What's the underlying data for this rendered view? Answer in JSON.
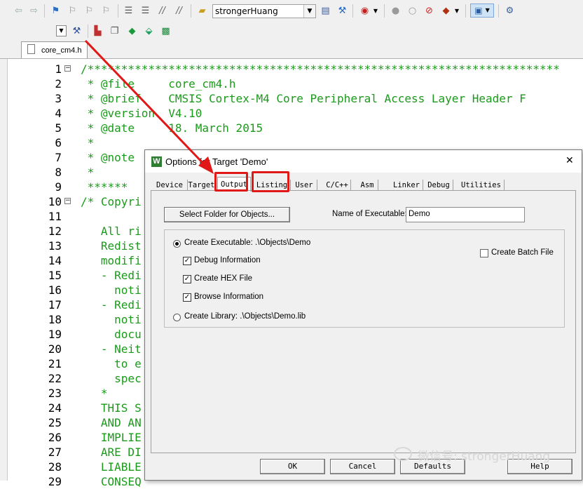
{
  "toolbar": {
    "target_name": "strongerHuang"
  },
  "file_tab": {
    "label": "core_cm4.h"
  },
  "editor": {
    "lines": [
      {
        "n": "1",
        "fold": "−",
        "text": "/**********************************************************************"
      },
      {
        "n": "2",
        "fold": "",
        "text": " * @file     core_cm4.h"
      },
      {
        "n": "3",
        "fold": "",
        "text": " * @brief    CMSIS Cortex-M4 Core Peripheral Access Layer Header F"
      },
      {
        "n": "4",
        "fold": "",
        "text": " * @version  V4.10"
      },
      {
        "n": "5",
        "fold": "",
        "text": " * @date     18. March 2015"
      },
      {
        "n": "6",
        "fold": "",
        "text": " *"
      },
      {
        "n": "7",
        "fold": "",
        "text": " * @note"
      },
      {
        "n": "8",
        "fold": "",
        "text": " *"
      },
      {
        "n": "9",
        "fold": "",
        "text": " ******"
      },
      {
        "n": "10",
        "fold": "−",
        "text": "/* Copyri"
      },
      {
        "n": "11",
        "fold": "",
        "text": ""
      },
      {
        "n": "12",
        "fold": "",
        "text": "   All ri"
      },
      {
        "n": "13",
        "fold": "",
        "text": "   Redist"
      },
      {
        "n": "14",
        "fold": "",
        "text": "   modifi"
      },
      {
        "n": "15",
        "fold": "",
        "text": "   - Redi"
      },
      {
        "n": "16",
        "fold": "",
        "text": "     noti"
      },
      {
        "n": "17",
        "fold": "",
        "text": "   - Redi"
      },
      {
        "n": "18",
        "fold": "",
        "text": "     noti"
      },
      {
        "n": "19",
        "fold": "",
        "text": "     docu"
      },
      {
        "n": "20",
        "fold": "",
        "text": "   - Neit"
      },
      {
        "n": "21",
        "fold": "",
        "text": "     to e"
      },
      {
        "n": "22",
        "fold": "",
        "text": "     spec"
      },
      {
        "n": "23",
        "fold": "",
        "text": "   *"
      },
      {
        "n": "24",
        "fold": "",
        "text": "   THIS S"
      },
      {
        "n": "25",
        "fold": "",
        "text": "   AND AN"
      },
      {
        "n": "26",
        "fold": "",
        "text": "   IMPLIE"
      },
      {
        "n": "27",
        "fold": "",
        "text": "   ARE DI"
      },
      {
        "n": "28",
        "fold": "",
        "text": "   LIABLE"
      },
      {
        "n": "29",
        "fold": "",
        "text": "   CONSEQ"
      }
    ]
  },
  "dialog": {
    "title": "Options for Target 'Demo'",
    "close_glyph": "✕",
    "tabs": [
      "Device",
      "Target",
      "Output",
      "Listing",
      "User",
      "C/C++",
      "Asm",
      "Linker",
      "Debug",
      "Utilities"
    ],
    "select_folder_button": "Select Folder for Objects...",
    "name_of_executable_label": "Name of Executable:",
    "name_of_executable_value": "Demo",
    "create_executable_label": "Create Executable:  .\\Objects\\Demo",
    "debug_information_label": "Debug Information",
    "create_hex_label": "Create HEX File",
    "browse_information_label": "Browse Information",
    "create_library_label": "Create Library:  .\\Objects\\Demo.lib",
    "create_batch_label": "Create Batch File",
    "buttons": {
      "ok": "OK",
      "cancel": "Cancel",
      "defaults": "Defaults",
      "help": "Help"
    }
  },
  "watermark": {
    "text": "微信号: strongerHuang"
  },
  "colors": {
    "comment_green": "#1a9a1a",
    "annotation_red": "#e01818"
  }
}
